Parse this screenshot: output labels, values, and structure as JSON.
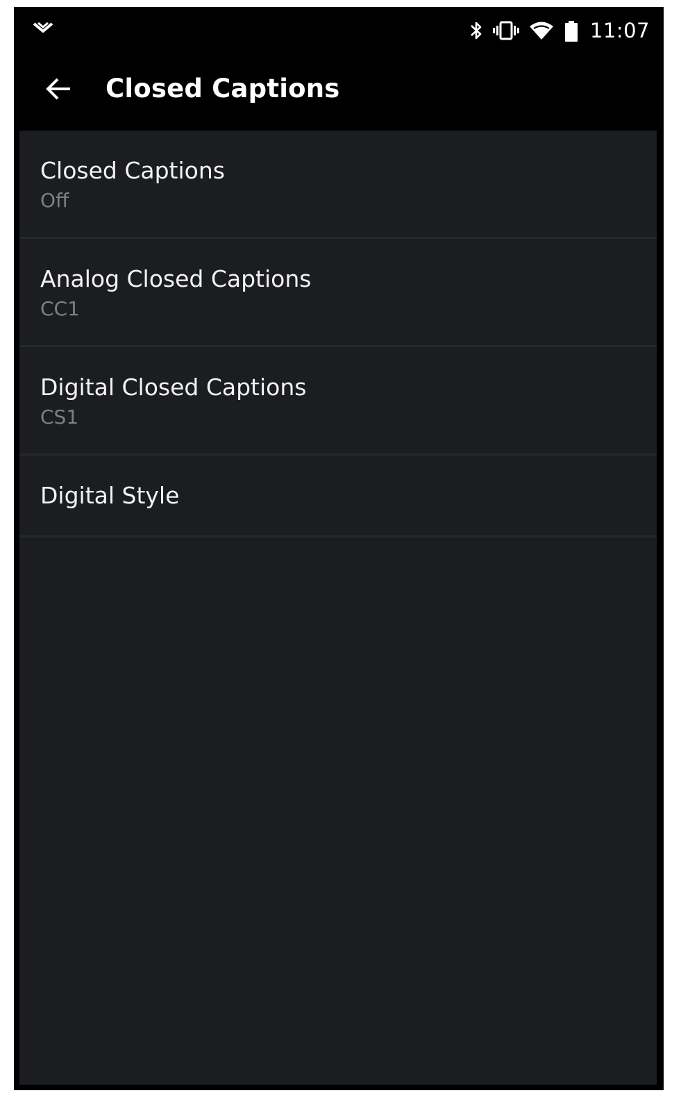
{
  "status_bar": {
    "time": "11:07",
    "icons": [
      "chevron-down-icon",
      "bluetooth-icon",
      "vibrate-icon",
      "wifi-icon",
      "battery-icon"
    ]
  },
  "app_bar": {
    "back_icon": "arrow-left-icon",
    "title": "Closed Captions"
  },
  "settings": {
    "items": [
      {
        "title": "Closed Captions",
        "value": "Off"
      },
      {
        "title": "Analog Closed Captions",
        "value": "CC1"
      },
      {
        "title": "Digital Closed Captions",
        "value": "CS1"
      },
      {
        "title": "Digital Style"
      }
    ]
  },
  "colors": {
    "background": "#000000",
    "list_background": "#1b1d21",
    "divider": "#25282d",
    "primary_text": "#f2f2f2",
    "secondary_text": "#7c7f84"
  }
}
